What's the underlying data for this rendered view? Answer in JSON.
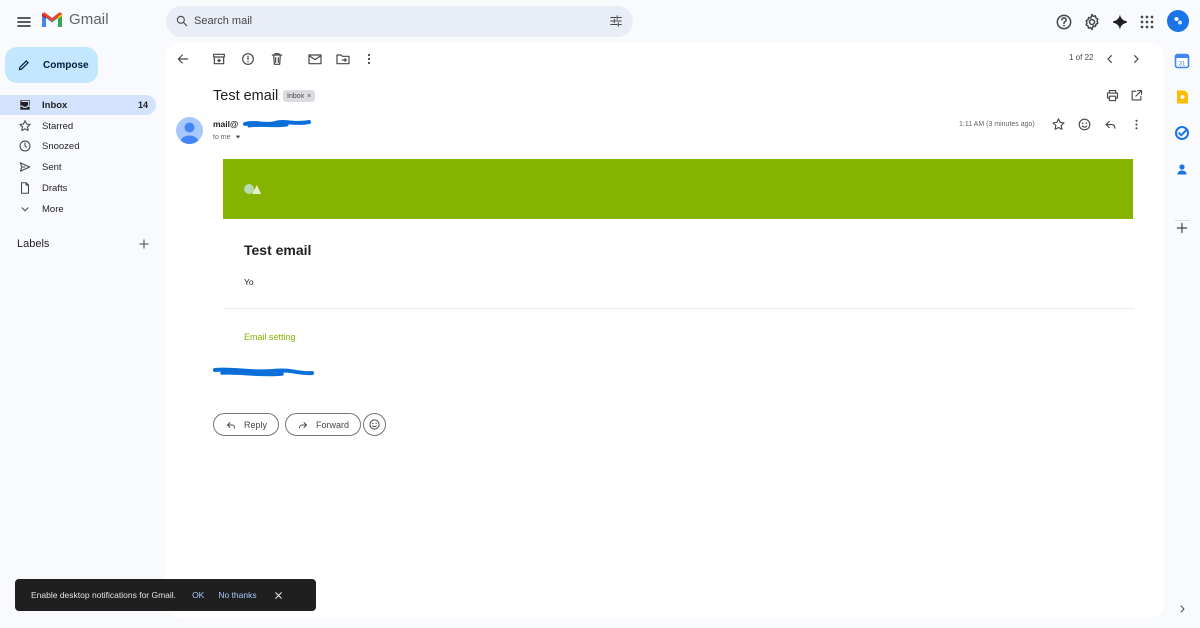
{
  "app": {
    "name": "Gmail"
  },
  "search": {
    "placeholder": "Search mail"
  },
  "compose": {
    "label": "Compose"
  },
  "nav": [
    {
      "label": "Inbox",
      "count": "14",
      "icon": "inbox-icon",
      "active": true
    },
    {
      "label": "Starred",
      "icon": "star-icon"
    },
    {
      "label": "Snoozed",
      "icon": "clock-icon"
    },
    {
      "label": "Sent",
      "icon": "send-icon"
    },
    {
      "label": "Drafts",
      "icon": "draft-icon"
    },
    {
      "label": "More",
      "icon": "chevron-down-icon"
    }
  ],
  "labels": {
    "heading": "Labels"
  },
  "toolbar": {
    "pager": "1 of 22"
  },
  "email": {
    "subject": "Test email",
    "chip": "Inbox",
    "sender": "mail@",
    "to": "to me",
    "time": "1:11 AM (3 minutes ago)",
    "body_title": "Test email",
    "body_text": "Yo",
    "link": "Email setting"
  },
  "actions": {
    "reply": "Reply",
    "forward": "Forward"
  },
  "snackbar": {
    "message": "Enable desktop notifications for Gmail.",
    "ok": "OK",
    "no_thanks": "No thanks"
  },
  "colors": {
    "banner": "#84b400",
    "link": "#84b400",
    "compose_bg": "#c2e7ff",
    "nav_active": "#d3e3fd",
    "redaction": "#0b6fd9"
  }
}
